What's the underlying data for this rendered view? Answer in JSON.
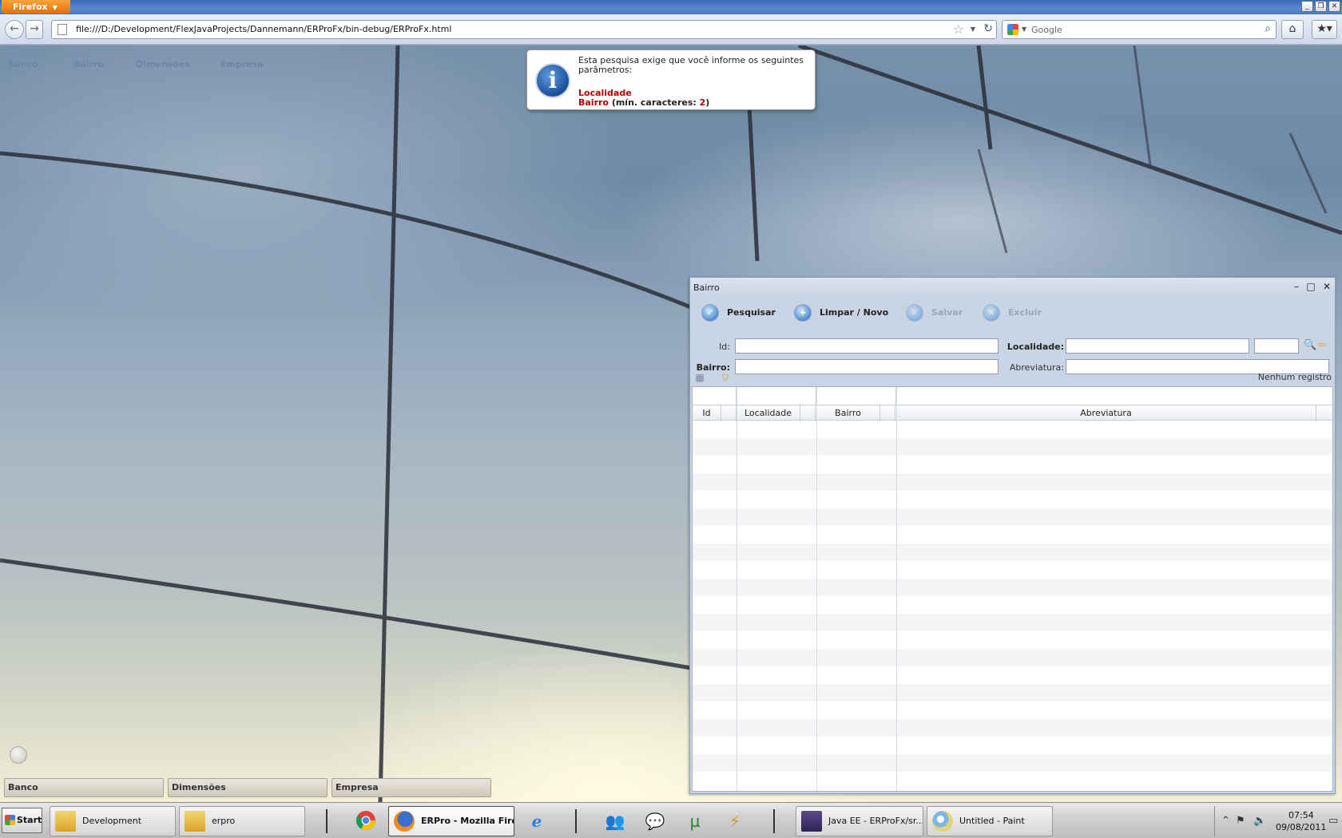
{
  "browser": {
    "menu_button": "Firefox",
    "url": "file:///D:/Development/FlexJavaProjects/Dannemann/ERProFx/bin-debug/ERProFx.html",
    "search_placeholder": "Google"
  },
  "app_menu": [
    "Banco",
    "Bairro",
    "Dimensões",
    "Empresa"
  ],
  "toast": {
    "message": "Esta pesquisa exige que você informe os seguintes parâmetros:",
    "param1": "Localidade",
    "param2_name": "Bairro",
    "param2_rest_open": " (mín. caracteres: ",
    "param2_num": "2",
    "param2_rest_close": ")"
  },
  "bairro_window": {
    "title": "Bairro",
    "toolbar": {
      "pesquisar": "Pesquisar",
      "limpar": "Limpar / Novo",
      "salvar": "Salvar",
      "excluir": "Excluir"
    },
    "fields": {
      "id_label": "Id:",
      "bairro_label": "Bairro:",
      "localidade_label": "Localidade:",
      "abreviatura_label": "Abreviatura:"
    },
    "status": "Nenhum registro",
    "columns": [
      "Id",
      "Localidade",
      "Bairro",
      "Abreviatura"
    ]
  },
  "dock_tabs": [
    "Banco",
    "Dimensões",
    "Empresa"
  ],
  "taskbar": {
    "start": "Start",
    "tasks": {
      "development": "Development",
      "erpro_folder": "erpro",
      "firefox": "ERPro - Mozilla Fire...",
      "java": "Java EE - ERProFx/sr...",
      "paint": "Untitled - Paint"
    },
    "clock_time": "07:54",
    "clock_date": "09/08/2011"
  }
}
